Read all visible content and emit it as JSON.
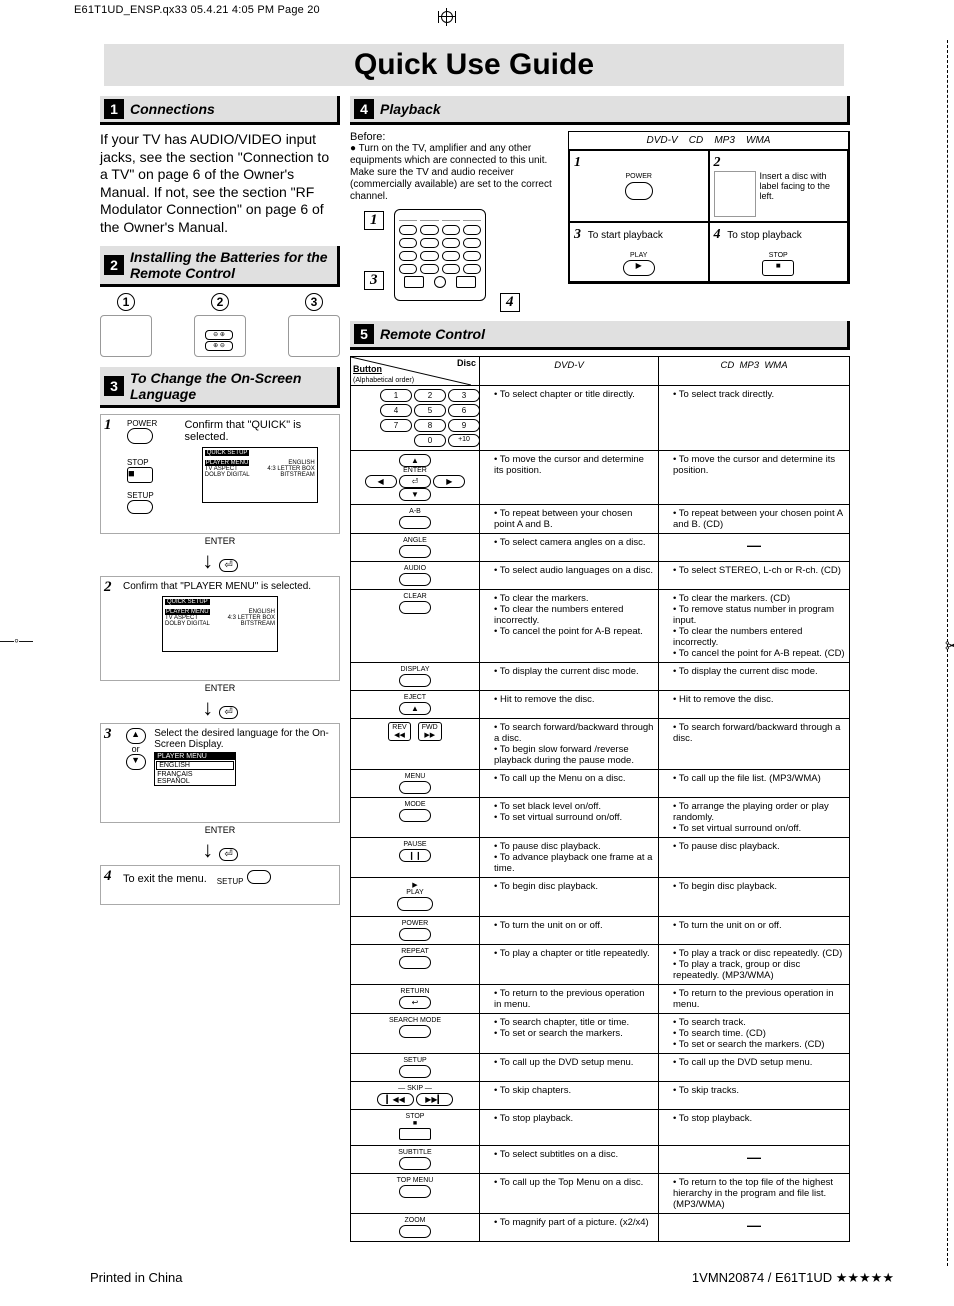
{
  "header": {
    "print_info": "E61T1UD_ENSP.qx33  05.4.21 4:05 PM  Page 20"
  },
  "title": "Quick Use Guide",
  "section1": {
    "num": "1",
    "title": "Connections",
    "body": "If your TV has AUDIO/VIDEO input jacks, see the section \"Connection to a TV\" on page 6 of the Owner's Manual. If not, see the section \"RF Modulator Connection\" on page 6 of the Owner's Manual."
  },
  "section2": {
    "num": "2",
    "title": "Installing the Batteries for the Remote Control",
    "steps": [
      "➀",
      "➁",
      "➂"
    ]
  },
  "section3": {
    "num": "3",
    "title": "To Change the On-Screen Language",
    "step1": {
      "num": "1",
      "txt": "Confirm that \"QUICK\" is selected.",
      "power": "POWER",
      "stop": "STOP",
      "setup": "SETUP"
    },
    "enter": "ENTER",
    "step2": {
      "num": "2",
      "txt": "Confirm that \"PLAYER MENU\" is selected."
    },
    "step3": {
      "num": "3",
      "txt": "Select the desired language for the On-Screen Display.",
      "langs": [
        "PLAYER MENU",
        "ENGLISH",
        "FRANÇAIS",
        "ESPAÑOL"
      ],
      "or": "or"
    },
    "step4": {
      "num": "4",
      "txt": "To exit the menu.",
      "setup": "SETUP"
    },
    "screen_items": {
      "row1": [
        "PLAYER MENU",
        "ENGLISH"
      ],
      "row2": [
        "TV ASPECT",
        "4:3 LETTER BOX"
      ],
      "row3": [
        "DOLBY DIGITAL",
        "BITSTREAM"
      ],
      "quick": "QUICK SETUP"
    }
  },
  "section4": {
    "num": "4",
    "title": "Playback",
    "before_label": "Before:",
    "before": "Turn on the TV, amplifier and any other equipments which are connected to this unit. Make sure the TV and audio receiver (commercially available) are set to the correct channel.",
    "discs": [
      "DVD-V",
      "CD",
      "MP3",
      "WMA"
    ],
    "g1": {
      "num": "1",
      "label": "POWER"
    },
    "g2": {
      "num": "2",
      "txt": "Insert a disc with label facing to the left."
    },
    "g3": {
      "num": "3",
      "txt": "To start playback",
      "btn": "PLAY"
    },
    "g4": {
      "num": "4",
      "txt": "To stop playback",
      "btn": "STOP"
    },
    "remote_nums": [
      "1",
      "3",
      "4"
    ]
  },
  "section5": {
    "num": "5",
    "title": "Remote Control",
    "head_button": "Button",
    "head_button_sub": "(Alphabetical order)",
    "head_disc": "Disc",
    "col_dvd": "DVD-V",
    "col_other": [
      "CD",
      "MP3",
      "WMA"
    ],
    "rows": [
      {
        "btn": "0-9 / +10",
        "btn_render": "numpad",
        "dvd": [
          "To select chapter or title directly."
        ],
        "cd": [
          "To select track directly."
        ]
      },
      {
        "btn": "ARROWS",
        "btn_label": "ENTER",
        "btn_render": "arrows",
        "dvd": [
          "To move the cursor and determine its position."
        ],
        "cd": [
          "To move the cursor and determine its position."
        ]
      },
      {
        "btn": "A-B",
        "dvd": [
          "To repeat between your chosen point A and B."
        ],
        "cd": [
          "To repeat between your chosen point A and B. (CD)"
        ]
      },
      {
        "btn": "ANGLE",
        "dvd": [
          "To select camera angles on a disc."
        ],
        "cd_dash": true
      },
      {
        "btn": "AUDIO",
        "dvd": [
          "To select audio languages on a disc."
        ],
        "cd": [
          "To select STEREO, L-ch or R-ch. (CD)"
        ]
      },
      {
        "btn": "CLEAR",
        "dvd": [
          "To clear the markers.",
          "To clear the numbers entered incorrectly.",
          "To cancel the point for A-B repeat."
        ],
        "cd": [
          "To clear the markers. (CD)",
          "To remove status number in program input.",
          "To clear the numbers entered incorrectly.",
          "To cancel the point for A-B repeat. (CD)"
        ]
      },
      {
        "btn": "DISPLAY",
        "dvd": [
          "To display the current disc mode."
        ],
        "cd": [
          "To display the current disc mode."
        ]
      },
      {
        "btn": "EJECT",
        "btn_render": "eject",
        "dvd": [
          "Hit to remove the disc."
        ],
        "cd": [
          "Hit to remove the disc."
        ]
      },
      {
        "btn": "REV / FWD",
        "btn_render": "revfwd",
        "dvd": [
          "To search forward/backward through a disc.",
          "To begin slow forward /reverse playback during the pause mode."
        ],
        "cd": [
          "To search forward/backward through a disc."
        ]
      },
      {
        "btn": "MENU",
        "dvd": [
          "To call up the Menu on a disc."
        ],
        "cd": [
          "To call up the file list. (MP3/WMA)"
        ]
      },
      {
        "btn": "MODE",
        "dvd": [
          "To set black level on/off.",
          "To set virtual surround on/off."
        ],
        "cd": [
          "To arrange the playing order or play randomly.",
          "To set virtual surround on/off."
        ]
      },
      {
        "btn": "PAUSE",
        "btn_render": "pause",
        "dvd": [
          "To pause disc playback.",
          "To advance playback one frame at a time."
        ],
        "cd": [
          "To pause disc playback."
        ]
      },
      {
        "btn": "PLAY",
        "btn_render": "play",
        "dvd": [
          "To begin disc playback."
        ],
        "cd": [
          "To begin disc playback."
        ]
      },
      {
        "btn": "POWER",
        "dvd": [
          "To turn the unit on or off."
        ],
        "cd": [
          "To turn the unit on or off."
        ]
      },
      {
        "btn": "REPEAT",
        "dvd": [
          "To play a chapter or title repeatedly."
        ],
        "cd": [
          "To play a track or disc repeatedly. (CD)",
          "To play a track, group or disc repeatedly. (MP3/WMA)"
        ]
      },
      {
        "btn": "RETURN",
        "btn_render": "return",
        "dvd": [
          "To return to the previous operation in menu."
        ],
        "cd": [
          "To return to the previous operation in menu."
        ]
      },
      {
        "btn": "SEARCH MODE",
        "dvd": [
          "To search chapter, title or time.",
          "To set or search the markers."
        ],
        "cd": [
          "To search track.",
          "To search time. (CD)",
          "To set or search the markers. (CD)"
        ]
      },
      {
        "btn": "SETUP",
        "dvd": [
          "To call up the DVD setup menu."
        ],
        "cd": [
          "To call up the DVD setup menu."
        ]
      },
      {
        "btn": "SKIP",
        "btn_render": "skip",
        "dvd": [
          "To skip chapters."
        ],
        "cd": [
          "To skip tracks."
        ]
      },
      {
        "btn": "STOP",
        "btn_render": "stop",
        "dvd": [
          "To stop playback."
        ],
        "cd": [
          "To stop playback."
        ]
      },
      {
        "btn": "SUBTITLE",
        "dvd": [
          "To select subtitles on a disc."
        ],
        "cd_dash": true
      },
      {
        "btn": "TOP MENU",
        "dvd": [
          "To call up the Top Menu on a disc."
        ],
        "cd": [
          "To return to the top file of the highest hierarchy in the program and file list. (MP3/WMA)"
        ]
      },
      {
        "btn": "ZOOM",
        "dvd": [
          "To magnify part of a picture. (x2/x4)"
        ],
        "cd_dash": true
      }
    ]
  },
  "footer": {
    "left": "Printed in China",
    "right": "1VMN20874 / E61T1UD ★★★★★"
  }
}
